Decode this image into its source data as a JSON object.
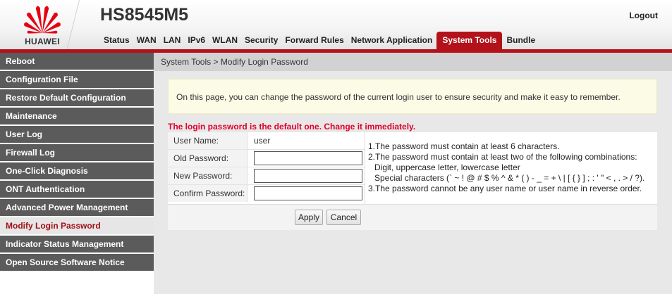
{
  "brand": {
    "name": "HUAWEI",
    "model": "HS8545M5",
    "logo_color": "#e60012"
  },
  "header": {
    "logout_label": "Logout"
  },
  "nav": {
    "items": [
      "Status",
      "WAN",
      "LAN",
      "IPv6",
      "WLAN",
      "Security",
      "Forward Rules",
      "Network Application",
      "System Tools",
      "Bundle"
    ],
    "active": "System Tools"
  },
  "sidebar": {
    "items": [
      "Reboot",
      "Configuration File",
      "Restore Default Configuration",
      "Maintenance",
      "User Log",
      "Firewall Log",
      "One-Click Diagnosis",
      "ONT Authentication",
      "Advanced Power Management",
      "Modify Login Password",
      "Indicator Status Management",
      "Open Source Software Notice"
    ],
    "active": "Modify Login Password"
  },
  "main": {
    "breadcrumb": "System Tools > Modify Login Password",
    "info": "On this page, you can change the password of the current login user to ensure security and make it easy to remember.",
    "warning": "The login password is the default one. Change it immediately.",
    "form": {
      "username_label": "User Name:",
      "username_value": "user",
      "old_password_label": "Old Password:",
      "new_password_label": "New Password:",
      "confirm_password_label": "Confirm Password:",
      "old_password_value": "",
      "new_password_value": "",
      "confirm_password_value": ""
    },
    "rules": [
      "1.The password must contain at least 6 characters.",
      "2.The password must contain at least two of the following combinations:",
      "Digit, uppercase letter, lowercase letter",
      "Special characters (` ~ ! @ # $ % ^ & * ( ) - _ = + \\ | [ { } ] ; : ' \" < , . > / ?).",
      "3.The password cannot be any user name or user name in reverse order."
    ],
    "apply_label": "Apply",
    "cancel_label": "Cancel"
  },
  "colors": {
    "accent": "#b4121b",
    "sidebar_bg": "#5b5b5b",
    "warning": "#e0002a",
    "info_bg": "#fbfbe6"
  }
}
